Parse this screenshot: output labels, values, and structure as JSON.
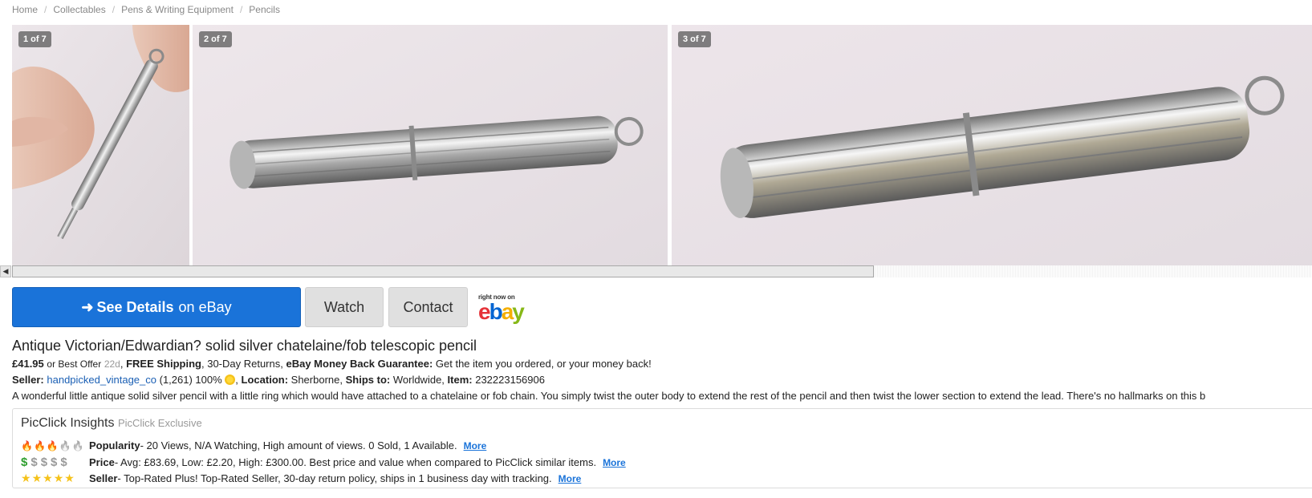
{
  "breadcrumb": [
    "Home",
    "Collectables",
    "Pens & Writing Equipment",
    "Pencils"
  ],
  "gallery": {
    "badges": [
      "1 of 7",
      "2 of 7",
      "3 of 7"
    ]
  },
  "actions": {
    "see_details_bold": "See Details",
    "see_details_rest": "on eBay",
    "watch": "Watch",
    "contact": "Contact",
    "ebay_tag": "right now on",
    "ebay_letters": [
      "e",
      "b",
      "a",
      "y"
    ]
  },
  "listing": {
    "title": "Antique Victorian/Edwardian? solid silver chatelaine/fob telescopic pencil",
    "price": "£41.95",
    "best_offer": "or Best Offer",
    "age": "22d",
    "shipping": "FREE Shipping",
    "returns": ", 30-Day Returns, ",
    "guarantee_label": "eBay Money Back Guarantee:",
    "guarantee_text": " Get the item you ordered, or your money back!",
    "seller_label": "Seller:",
    "seller_name": "handpicked_vintage_co",
    "seller_stats": "(1,261) 100%",
    "location_label": "Location:",
    "location": "Sherborne,",
    "ships_label": "Ships to:",
    "ships_to": "Worldwide,",
    "item_label": "Item:",
    "item_number": "232223156906",
    "description": "A wonderful little antique solid silver pencil with a little ring which would have attached to a chatelaine or fob chain. You simply twist the outer body to extend the rest of the pencil and then twist the lower section to extend the lead. There's no hallmarks on this b"
  },
  "insights": {
    "title": "PicClick Insights",
    "exclusive": "PicClick Exclusive",
    "popularity_label": "Popularity",
    "popularity_text": " - 20 Views, N/A Watching, High amount of views. 0 Sold, 1 Available.",
    "popularity_level": 3,
    "price_label": "Price",
    "price_text": " - Avg: £83.69, Low: £2.20, High: £300.00. Best price and value when compared to PicClick similar items.",
    "price_level": 1,
    "seller_label": "Seller",
    "seller_text": " - Top-Rated Plus! Top-Rated Seller, 30-day return policy, ships in 1 business day with tracking.",
    "seller_level": 5,
    "more": "More"
  },
  "colors": {
    "primary_button": "#1a73d9",
    "link": "#1a5fb4",
    "ebay_e": "#e53238",
    "ebay_b": "#0064d2",
    "ebay_a": "#f5af02",
    "ebay_y": "#86b817"
  },
  "icons": [
    "arrow-right-icon",
    "flame-icon",
    "dollar-icon",
    "star-icon",
    "sun-badge-icon"
  ]
}
